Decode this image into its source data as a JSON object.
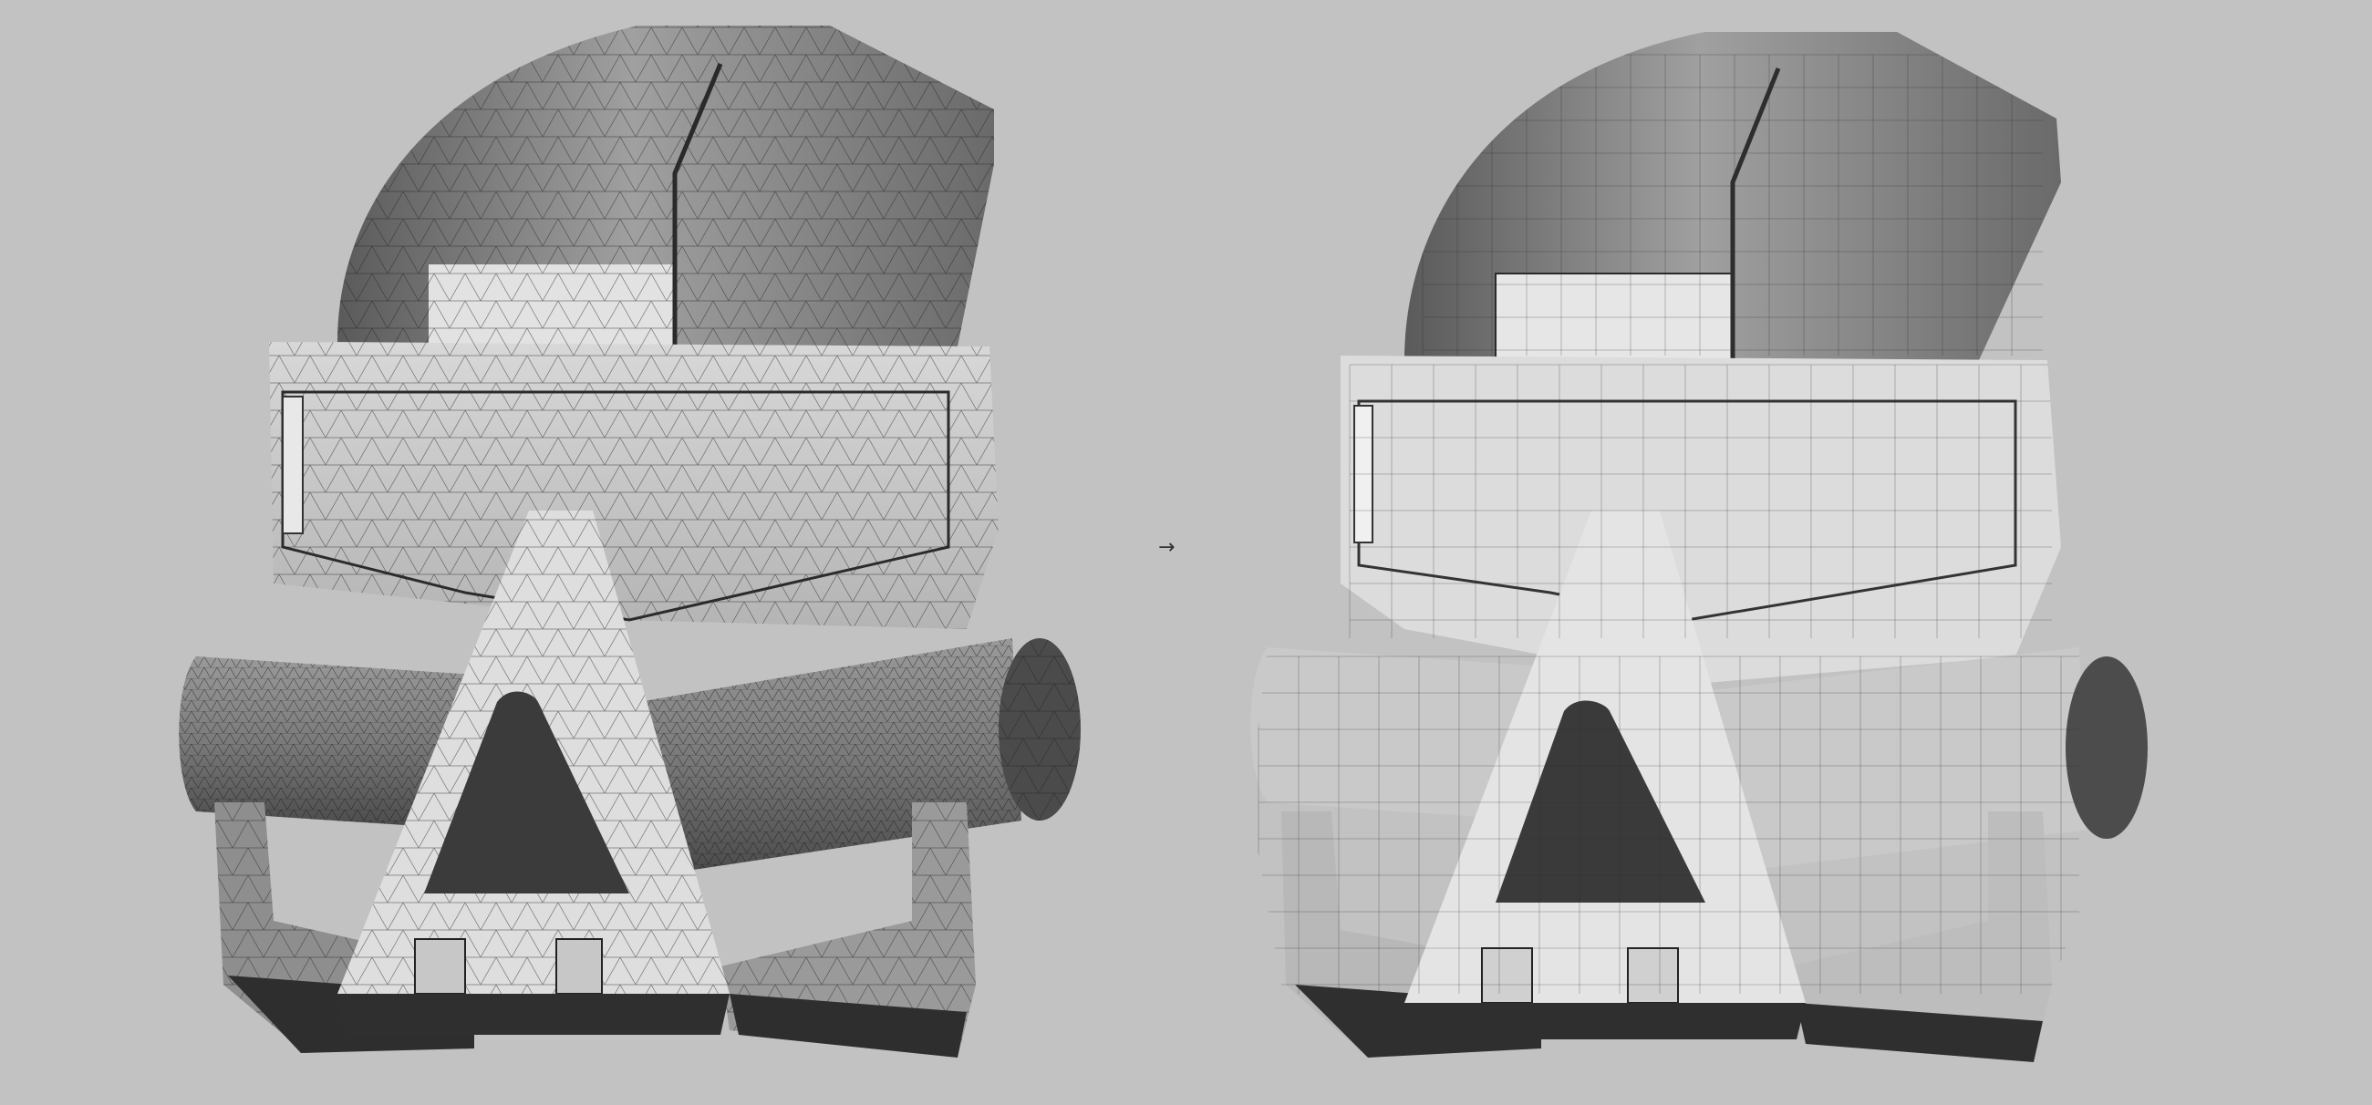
{
  "scene": {
    "background_color": "#c2c2c2",
    "arrow_glyph": "→",
    "arrow_color": "#333333",
    "left_model": {
      "name": "triangulated-mesh",
      "wire_color": "#1f1f1f",
      "shade_light": "#e4e4e4",
      "shade_mid": "#a8a8a8",
      "shade_dark": "#3c3c3c"
    },
    "right_model": {
      "name": "quad-retopology-mesh",
      "wire_color": "#2a2a2a",
      "shade_light": "#ececec",
      "shade_mid": "#b3b3b3",
      "shade_dark": "#444444"
    }
  }
}
